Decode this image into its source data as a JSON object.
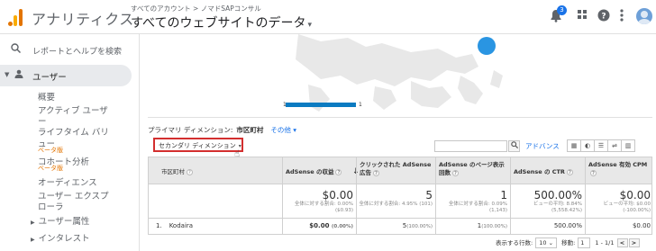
{
  "header": {
    "app_name": "アナリティクス",
    "breadcrumb": "すべてのアカウント > ノマドSAPコンサル",
    "view_title": "すべてのウェブサイトのデータ",
    "view_caret": "▾",
    "notification_count": "3",
    "icons": [
      "bell-icon",
      "apps-icon",
      "help-icon",
      "more-vert-icon",
      "avatar"
    ]
  },
  "sidebar": {
    "search_label": "レポートとヘルプを検索",
    "section_label": "ユーザー",
    "items": [
      {
        "label": "概要"
      },
      {
        "label": "アクティブ ユーザ"
      },
      {
        "label": "ー"
      },
      {
        "label": "ライフタイム バリ"
      },
      {
        "label": "ュー"
      },
      {
        "label": "コホート分析"
      }
    ],
    "beta_label": "ベータ版",
    "items2": [
      {
        "label": "オーディエンス"
      },
      {
        "label": "ユーザー エクスプ"
      },
      {
        "label": "ローラ"
      }
    ],
    "sub_sections": [
      {
        "label": "ユーザー属性"
      },
      {
        "label": "インタレスト"
      }
    ]
  },
  "map": {
    "legend_min": "1",
    "legend_max": "1",
    "colors": {
      "bubble": "#0b7bc1",
      "land": "#e8e8e8"
    }
  },
  "controls": {
    "primary_dimension_label": "プライマリ ディメンション:",
    "primary_dimension_value": "市区町村",
    "other_label": "その他",
    "other_caret": "▾",
    "secondary_dimension_label": "セカンダリ ディメンション",
    "secondary_caret": "▾",
    "advanced_label": "アドバンス",
    "search_placeholder": ""
  },
  "table": {
    "columns": [
      {
        "label": "市区町村"
      },
      {
        "label": "AdSense の収益"
      },
      {
        "label": "クリックされた AdSense 広告"
      },
      {
        "label": "AdSense のページ表示回数"
      },
      {
        "label": "AdSense の CTR"
      },
      {
        "label": "AdSense 有効 CPM"
      }
    ],
    "totals": [
      {
        "big": "$0.00",
        "small": "全体に対する割合: 0.00% ($0.93)"
      },
      {
        "big": "5",
        "small": "全体に対する割合: 4.95% (101)"
      },
      {
        "big": "1",
        "small": "全体に対する割合: 0.09% (1,143)"
      },
      {
        "big": "500.00%",
        "small": "ビューの平均: 8.84% (5,558.42%)"
      },
      {
        "big": "$0.00",
        "small": "ビューの平均: $0.00 (-100.00%)"
      }
    ],
    "rows": [
      {
        "index": "1.",
        "city": "Kodaira",
        "revenue": "$0.00",
        "revenue_pct": "(0.00%)",
        "clicks": "5",
        "clicks_pct": "(100.00%)",
        "views": "1",
        "views_pct": "(100.00%)",
        "ctr": "500.00%",
        "cpm": "$0.00"
      }
    ]
  },
  "pager": {
    "rows_label": "表示する行数:",
    "rows_value": "10",
    "goto_label": "移動:",
    "goto_value": "1",
    "range": "1 - 1/1",
    "prev": "<",
    "next": ">"
  }
}
